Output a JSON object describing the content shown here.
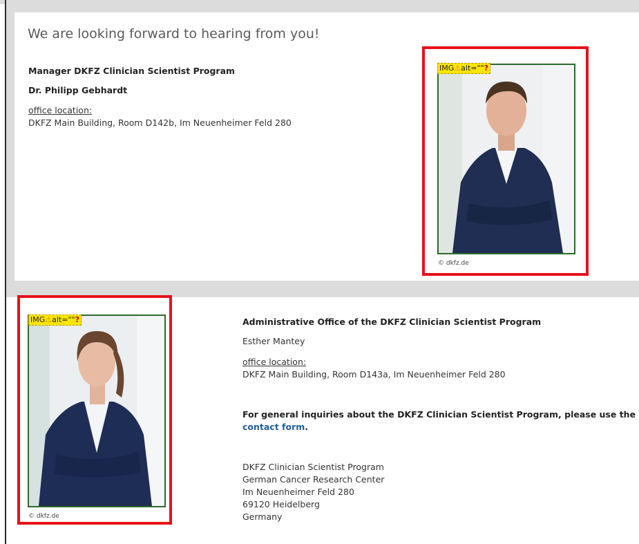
{
  "top": {
    "heading": "We are looking forward to hearing from you!",
    "role": "Manager DKFZ Clinician Scientist Program",
    "name": "Dr. Philipp Gebhardt",
    "office_label": "office location:",
    "office_value": "DKFZ Main Building, Room D142b, Im Neuenheimer Feld 280",
    "image": {
      "tag_prefix": "IMG",
      "tag_alt": "alt=\"\"",
      "credit": "© dkfz.de"
    }
  },
  "bottom": {
    "role": "Administrative Office of the DKFZ Clinician Scientist Program",
    "name": "Esther Mantey",
    "office_label": "office location:",
    "office_value": "DKFZ Main Building, Room D143a, Im Neuenheimer Feld 280",
    "inquiry_text": "For general inquiries about the DKFZ Clinician Scientist Program, please use the",
    "contact_link": "contact form",
    "inquiry_end": ".",
    "address": [
      "DKFZ Clinician Scientist Program",
      "German Cancer Research Center",
      "Im Neuenheimer Feld 280",
      "69120 Heidelberg",
      "Germany"
    ],
    "image": {
      "tag_prefix": "IMG",
      "tag_alt": "alt=\"\"",
      "credit": "© dkfz.de"
    }
  },
  "icons": {
    "warning": "warning-triangle-icon",
    "question": "question-mark-icon"
  },
  "colors": {
    "highlight_box": "#e8101a",
    "image_tag": "#ffe600",
    "link": "#1f5f99",
    "photo_border": "#2c6a2c"
  }
}
